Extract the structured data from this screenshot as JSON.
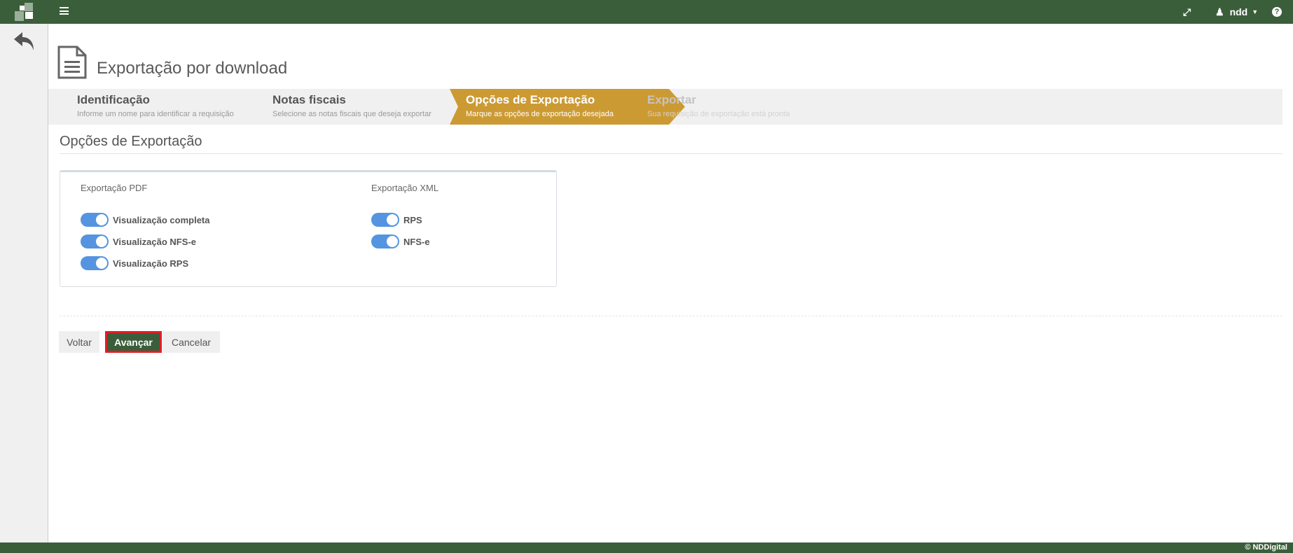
{
  "header": {
    "user": "ndd",
    "icons": [
      "expand-icon",
      "user-icon",
      "caret-down-icon",
      "help-icon"
    ]
  },
  "page": {
    "title": "Exportação por download"
  },
  "wizard": {
    "steps": [
      {
        "title": "Identificação",
        "subtitle": "Informe um nome para identificar a requisição",
        "state": "done"
      },
      {
        "title": "Notas fiscais",
        "subtitle": "Selecione as notas fiscais que deseja exportar",
        "state": "done"
      },
      {
        "title": "Opções de Exportação",
        "subtitle": "Marque as opções de exportação desejada",
        "state": "active"
      },
      {
        "title": "Exportar",
        "subtitle": "Sua requisição de exportação está pronta",
        "state": "pending"
      }
    ],
    "active_color": "#cc9a33"
  },
  "section": {
    "title": "Opções de Exportação"
  },
  "options": {
    "pdf": {
      "label": "Exportação PDF",
      "items": [
        {
          "label": "Visualização completa",
          "on": true
        },
        {
          "label": "Visualização NFS-e",
          "on": true
        },
        {
          "label": "Visualização RPS",
          "on": true
        }
      ]
    },
    "xml": {
      "label": "Exportação XML",
      "items": [
        {
          "label": "RPS",
          "on": true
        },
        {
          "label": "NFS-e",
          "on": true
        }
      ]
    }
  },
  "buttons": {
    "back": "Voltar",
    "next": "Avançar",
    "cancel": "Cancelar"
  },
  "footer": {
    "copyright": "© NDDigital"
  },
  "colors": {
    "brand": "#3a5e3a",
    "toggle": "#5594e0",
    "highlight": "#e01e26"
  }
}
